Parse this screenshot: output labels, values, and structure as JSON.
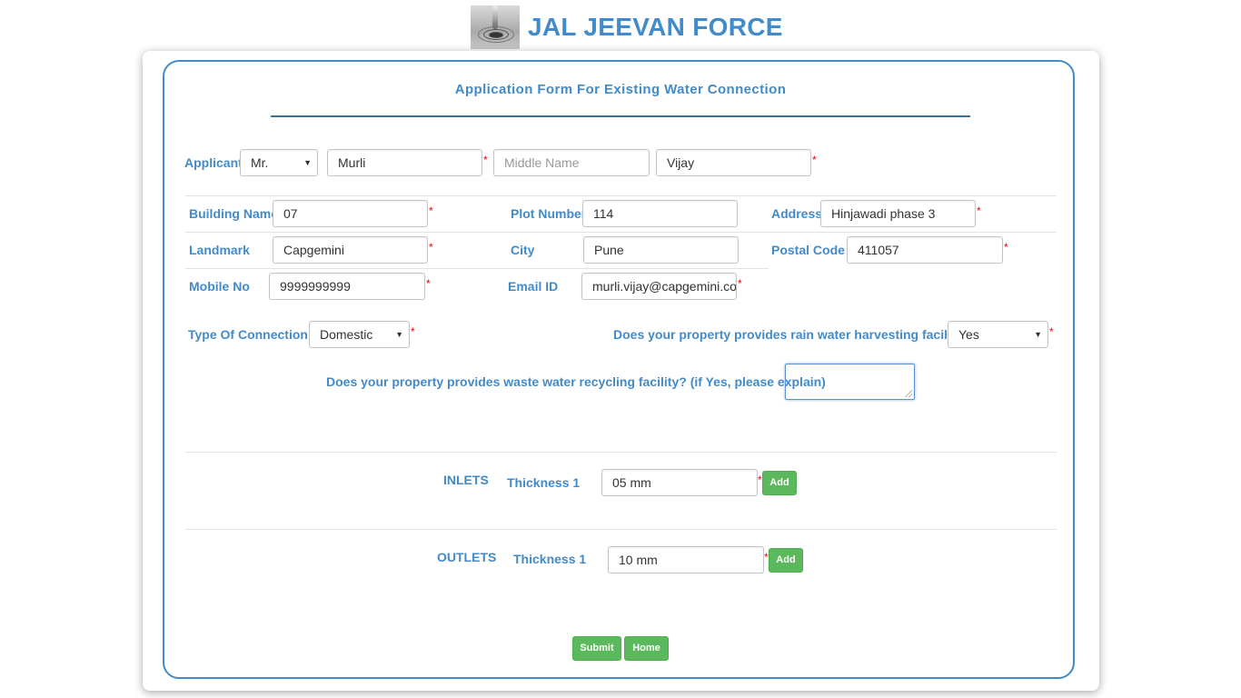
{
  "header": {
    "brand": "JAL JEEVAN FORCE",
    "logo_icon": "water-drop-logo-icon"
  },
  "form": {
    "title": "Application Form For Existing Water Connection",
    "applicant": {
      "label": "Applicant",
      "salutation": "Mr.",
      "first_name": "Murli",
      "middle_name_placeholder": "Middle Name",
      "last_name": "Vijay"
    },
    "address": {
      "building_name_label": "Building Name",
      "building_name": "07",
      "plot_number_label": "Plot Number",
      "plot_number": "114",
      "address_label": "Address",
      "address": "Hinjawadi phase 3",
      "landmark_label": "Landmark",
      "landmark": "Capgemini",
      "city_label": "City",
      "city": "Pune",
      "postal_code_label": "Postal Code",
      "postal_code": "411057",
      "mobile_label": "Mobile No",
      "mobile": "9999999999",
      "email_label": "Email ID",
      "email": "murli.vijay@capgemini.com"
    },
    "connection": {
      "type_label": "Type Of Connection",
      "type_value": "Domestic",
      "rain_harvest_label": "Does your property provides rain water harvesting facility?",
      "rain_harvest_value": "Yes",
      "waste_water_label": "Does your property provides waste water recycling facility? (if Yes, please explain)",
      "waste_water_value": ""
    },
    "inlets": {
      "label": "INLETS",
      "thickness_label": "Thickness 1",
      "thickness_value": "05 mm",
      "add_label": "Add"
    },
    "outlets": {
      "label": "OUTLETS",
      "thickness_label": "Thickness 1",
      "thickness_value": "10 mm",
      "add_label": "Add"
    },
    "required_mark": "*",
    "submit_label": "Submit",
    "home_label": "Home"
  },
  "colors": {
    "accent": "#428bca",
    "button": "#5cb85c",
    "required": "#e00000"
  }
}
